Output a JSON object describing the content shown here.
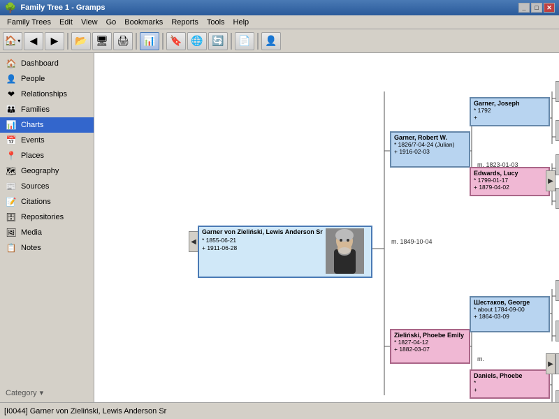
{
  "titleBar": {
    "title": "Family Tree 1 - Gramps",
    "icon": "🌳"
  },
  "menuBar": {
    "items": [
      "Family Trees",
      "Edit",
      "View",
      "Go",
      "Bookmarks",
      "Reports",
      "Tools",
      "Help"
    ]
  },
  "toolbar": {
    "buttons": [
      {
        "name": "home",
        "icon": "🏠"
      },
      {
        "name": "back",
        "icon": "◀"
      },
      {
        "name": "forward",
        "icon": "▶"
      },
      {
        "name": "open",
        "icon": "📂"
      },
      {
        "name": "fullscreen",
        "icon": "🖥"
      },
      {
        "name": "print",
        "icon": "🖨"
      },
      {
        "name": "chart",
        "icon": "📊"
      },
      {
        "name": "bookmark",
        "icon": "🔖"
      },
      {
        "name": "export",
        "icon": "🌐"
      },
      {
        "name": "refresh",
        "icon": "🔄"
      },
      {
        "name": "blank",
        "icon": "📄"
      },
      {
        "name": "person",
        "icon": "👤"
      }
    ]
  },
  "sidebar": {
    "items": [
      {
        "id": "dashboard",
        "label": "Dashboard",
        "icon": "🏠"
      },
      {
        "id": "people",
        "label": "People",
        "icon": "👤"
      },
      {
        "id": "relationships",
        "label": "Relationships",
        "icon": "❤"
      },
      {
        "id": "families",
        "label": "Families",
        "icon": "👨‍👩‍👧"
      },
      {
        "id": "charts",
        "label": "Charts",
        "icon": "📊",
        "active": true
      },
      {
        "id": "events",
        "label": "Events",
        "icon": "📅"
      },
      {
        "id": "places",
        "label": "Places",
        "icon": "📍"
      },
      {
        "id": "geography",
        "label": "Geography",
        "icon": "🗺"
      },
      {
        "id": "sources",
        "label": "Sources",
        "icon": "📰"
      },
      {
        "id": "citations",
        "label": "Citations",
        "icon": "📝"
      },
      {
        "id": "repositories",
        "label": "Repositories",
        "icon": "🗄"
      },
      {
        "id": "media",
        "label": "Media",
        "icon": "🖼"
      },
      {
        "id": "notes",
        "label": "Notes",
        "icon": "📋"
      }
    ],
    "category": "Category"
  },
  "chart": {
    "mainPerson": {
      "name": "Garner von Zieliński, Lewis Anderson Sr",
      "birth": "* 1855-06-21",
      "death": "+ 1911-06-28"
    },
    "father": {
      "name": "Garner, Robert W.",
      "birth": "* 1826/7-04-24 (Julian)",
      "death": "+ 1916-02-03"
    },
    "fatherFather": {
      "name": "Garner, Joseph",
      "birth": "* 1792",
      "death": "+"
    },
    "fatherMother": {
      "name": "Edwards, Lucy",
      "birth": "* 1799-01-17",
      "death": "+ 1879-04-02"
    },
    "mother": {
      "name": "Zieliński, Phoebe Emily",
      "birth": "* 1827-04-12",
      "death": "+ 1882-03-07"
    },
    "motherFather": {
      "name": "Шестаков, George",
      "birth": "* about 1784-09-00",
      "death": "+ 1864-03-09"
    },
    "motherMother": {
      "name": "Daniels, Phoebe",
      "birth": "*",
      "death": "+"
    },
    "marriage1": "m. 1823-01-03",
    "marriage2": "m. 1849-10-04",
    "marriage3": "m.",
    "scrollLeft": "◀",
    "scrollRight": "▶"
  },
  "statusBar": {
    "text": "[I0044] Garner von Zieliński, Lewis Anderson Sr"
  }
}
